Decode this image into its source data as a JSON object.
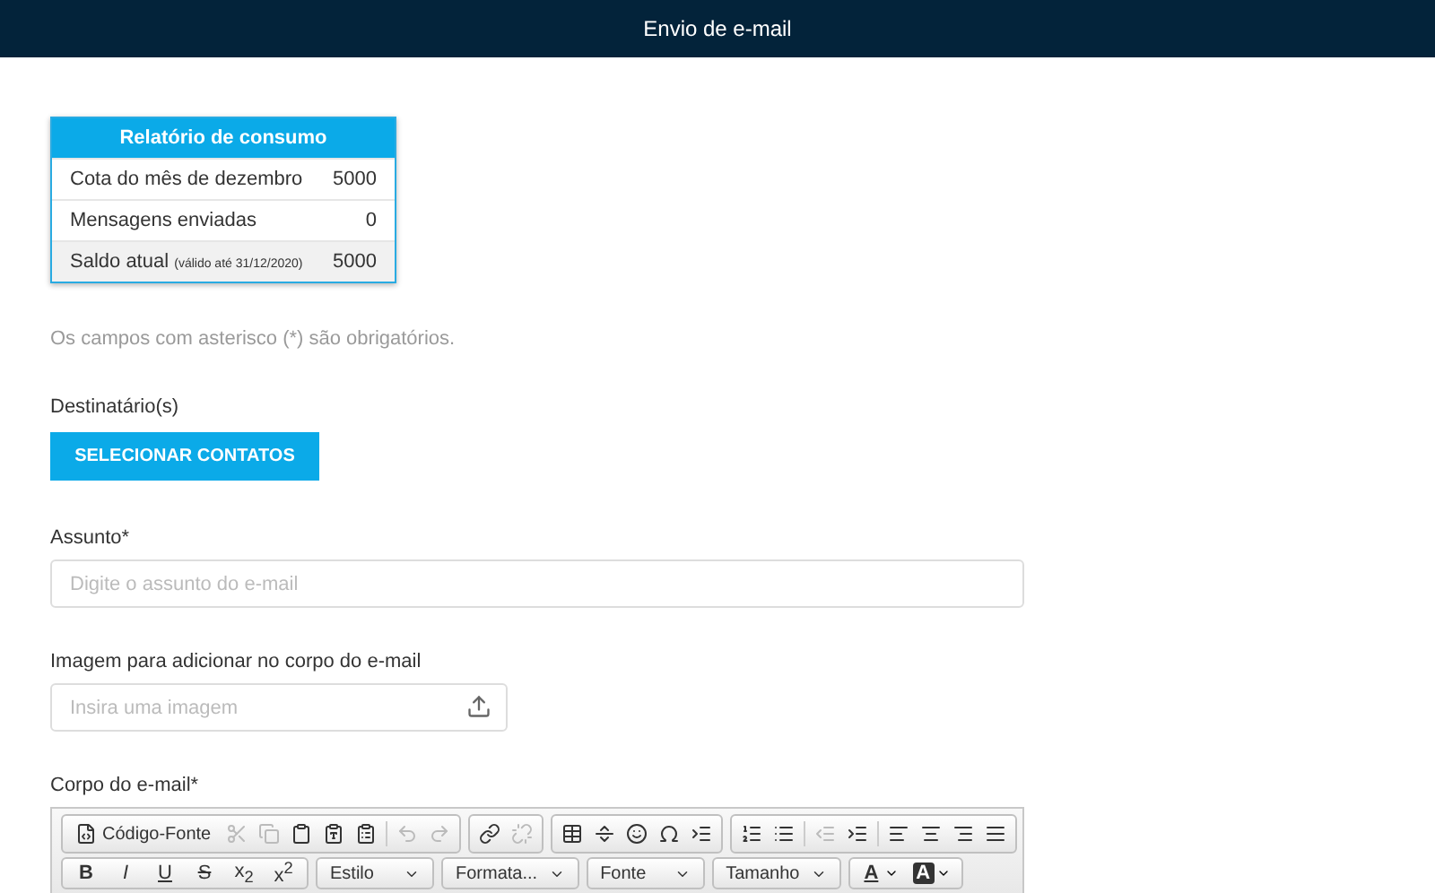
{
  "header": {
    "title": "Envio de e-mail"
  },
  "report": {
    "title": "Relatório de consumo",
    "rows": [
      {
        "label": "Cota do mês de dezembro",
        "value": "5000",
        "highlighted": false
      },
      {
        "label": "Mensagens enviadas",
        "value": "0",
        "highlighted": false
      },
      {
        "label": "Saldo atual",
        "note": "(válido até 31/12/2020)",
        "value": "5000",
        "highlighted": true
      }
    ]
  },
  "required_note": "Os campos com asterisco (*) são obrigatórios.",
  "recipients": {
    "label": "Destinatário(s)",
    "button": "SELECIONAR CONTATOS"
  },
  "subject": {
    "label": "Assunto*",
    "placeholder": "Digite o assunto do e-mail"
  },
  "image": {
    "label": "Imagem para adicionar no corpo do e-mail",
    "placeholder": "Insira uma imagem"
  },
  "body": {
    "label": "Corpo do e-mail*",
    "toolbar_rows": [
      [
        {
          "buttons": [
            {
              "kind": "source",
              "label": "Código-Fonte",
              "disabled": false
            },
            {
              "kind": "icon",
              "disabled": true
            },
            {
              "kind": "icon",
              "disabled": true
            },
            {
              "kind": "icon",
              "disabled": false
            },
            {
              "kind": "icon",
              "disabled": false
            },
            {
              "kind": "icon",
              "disabled": false
            },
            {
              "kind": "separator"
            },
            {
              "kind": "icon",
              "disabled": true
            },
            {
              "kind": "icon",
              "disabled": true
            }
          ]
        },
        {
          "buttons": [
            {
              "kind": "icon",
              "disabled": false
            },
            {
              "kind": "icon",
              "disabled": true
            }
          ]
        },
        {
          "buttons": [
            {
              "kind": "icon",
              "disabled": false
            },
            {
              "kind": "icon",
              "disabled": false
            },
            {
              "kind": "icon",
              "disabled": false
            },
            {
              "kind": "icon",
              "disabled": false
            },
            {
              "kind": "icon",
              "disabled": false
            }
          ]
        },
        {
          "buttons": [
            {
              "kind": "icon",
              "disabled": false
            },
            {
              "kind": "icon",
              "disabled": false
            },
            {
              "kind": "separator"
            },
            {
              "kind": "icon",
              "disabled": true
            },
            {
              "kind": "icon",
              "disabled": false
            },
            {
              "kind": "separator"
            },
            {
              "kind": "icon",
              "disabled": false
            },
            {
              "kind": "icon",
              "disabled": false
            },
            {
              "kind": "icon",
              "disabled": false
            },
            {
              "kind": "icon",
              "disabled": false
            }
          ]
        }
      ],
      [
        {
          "buttons": [
            {
              "kind": "format",
              "label": "B"
            },
            {
              "kind": "format",
              "label": "I"
            },
            {
              "kind": "format",
              "label": "U"
            },
            {
              "kind": "format",
              "label": "S"
            },
            {
              "kind": "format",
              "label": "x$_{2}$"
            },
            {
              "kind": "format",
              "label": "x$^{2}$"
            }
          ]
        },
        {
          "buttons": [
            {
              "kind": "combo",
              "label": "Estilo"
            }
          ]
        },
        {
          "buttons": [
            {
              "kind": "combo",
              "label": "Formata..."
            }
          ]
        },
        {
          "buttons": [
            {
              "kind": "combo",
              "label": "Fonte"
            }
          ]
        },
        {
          "buttons": [
            {
              "kind": "combo",
              "label": "Tamanho"
            }
          ]
        },
        {
          "buttons": [
            {
              "kind": "color",
              "label": "A",
              "filled": false
            },
            {
              "kind": "color",
              "label": "A",
              "filled": true
            }
          ]
        }
      ]
    ]
  }
}
